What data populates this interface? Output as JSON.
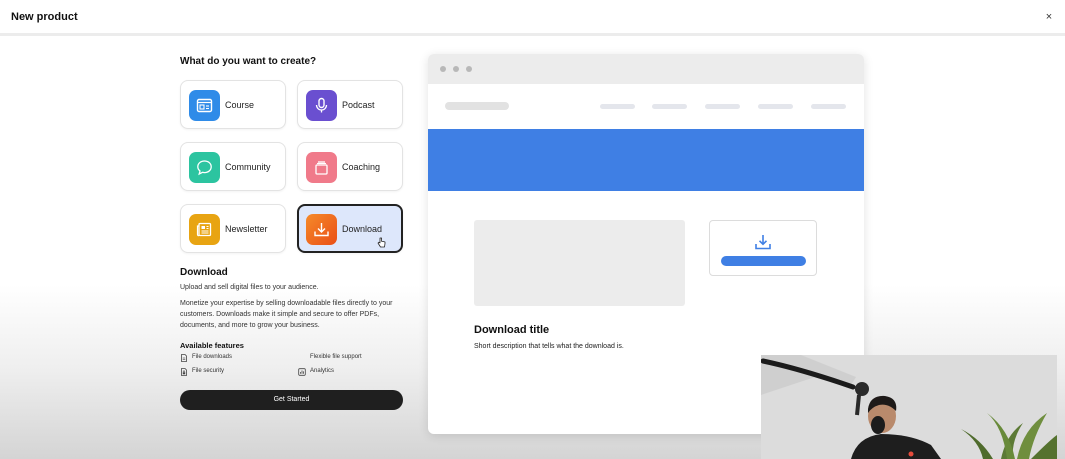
{
  "modal": {
    "title": "New product",
    "close_glyph": "×"
  },
  "chooser": {
    "heading": "What do you want to create?",
    "options": [
      {
        "label": "Course",
        "icon": "course-icon",
        "color": "#2f8be8",
        "selected": false
      },
      {
        "label": "Podcast",
        "icon": "microphone-icon",
        "color": "#6a4fd0",
        "selected": false
      },
      {
        "label": "Community",
        "icon": "chat-bubble-icon",
        "color": "#2cc4a0",
        "selected": false
      },
      {
        "label": "Coaching",
        "icon": "coaching-icon",
        "color": "#f07a8a",
        "selected": false
      },
      {
        "label": "Newsletter",
        "icon": "newspaper-icon",
        "color": "#e8a412",
        "selected": false
      },
      {
        "label": "Download",
        "icon": "download-icon",
        "color": "#f06a22",
        "selected": true
      }
    ]
  },
  "description": {
    "title": "Download",
    "subtitle": "Upload and sell digital files to your audience.",
    "body": "Monetize your expertise by selling downloadable files directly to your customers. Downloads make it simple and secure to offer PDFs, documents, and more to grow your business.",
    "features_title": "Available features",
    "features": [
      {
        "label": "File downloads",
        "icon": "file-icon"
      },
      {
        "label": "Flexible file support",
        "icon": ""
      },
      {
        "label": "File security",
        "icon": "lock-file-icon"
      },
      {
        "label": "Analytics",
        "icon": "analytics-icon"
      }
    ],
    "cta_label": "Get Started"
  },
  "preview": {
    "download_title": "Download title",
    "download_description": "Short description that tells what the download is.",
    "accent_color": "#3f7fe4"
  }
}
